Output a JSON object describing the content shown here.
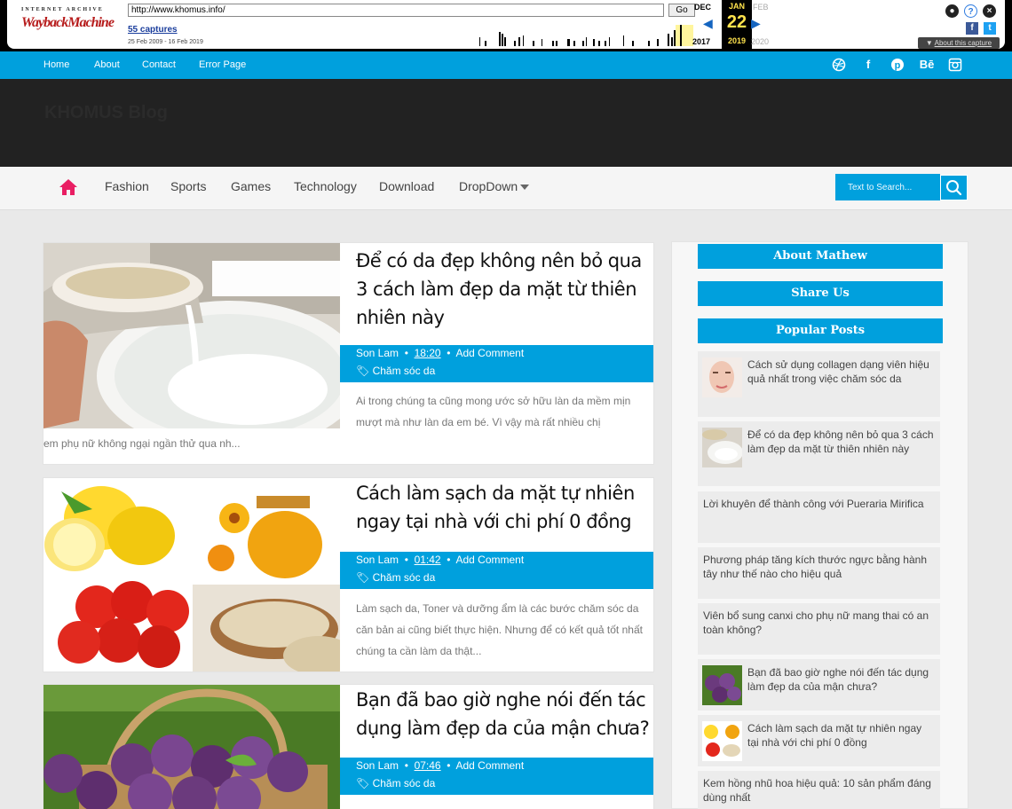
{
  "wayback": {
    "logo_top": "INTERNET ARCHIVE",
    "logo": "WaybackMachine",
    "url": "http://www.khomus.info/",
    "go_label": "Go",
    "captures": "55 captures",
    "range": "25 Feb 2009 - 16 Feb 2019",
    "prev_month": "DEC",
    "cur_month": "JAN",
    "next_month": "FEB",
    "day": "22",
    "prev_year": "2017",
    "cur_year": "2019",
    "next_year": "2020",
    "about": "About this capture"
  },
  "topnav": {
    "items": [
      "Home",
      "About",
      "Contact",
      "Error Page"
    ]
  },
  "social": [
    "dribbble-icon",
    "facebook-icon",
    "pinterest-icon",
    "behance-icon",
    "instagram-icon"
  ],
  "header": {
    "site_title": "KHOMUS Blog"
  },
  "mainnav": {
    "items": [
      "Fashion",
      "Sports",
      "Games",
      "Technology",
      "Download",
      "DropDown"
    ],
    "search_placeholder": "Text to Search..."
  },
  "posts": [
    {
      "title": "Để có da đẹp không nên bỏ qua 3 cách làm đẹp da mặt từ thiên nhiên này",
      "author": "Son Lam",
      "time": "18:20",
      "comment": "Add Comment",
      "category": "Chăm sóc da",
      "excerpt": "Ai trong chúng ta cũng mong ước sở hữu làn da mềm mịn mượt mà như làn da em bé. Vì vậy mà rất nhiều chị em phụ nữ không ngại ngần thử qua nh..."
    },
    {
      "title": "Cách làm sạch da mặt tự nhiên ngay tại nhà với chi phí 0 đồng",
      "author": "Son Lam",
      "time": "01:42",
      "comment": "Add Comment",
      "category": "Chăm sóc da",
      "excerpt": "Làm sạch da, Toner và dưỡng ẩm là các bước chăm sóc da căn bản ai cũng biết thực hiện. Nhưng để có kết quả tốt nhất chúng ta cần làm da thật..."
    },
    {
      "title": "Bạn đã bao giờ nghe nói đến tác dụng làm đẹp da của mận chưa?",
      "author": "Son Lam",
      "time": "07:46",
      "comment": "Add Comment",
      "category": "Chăm sóc da"
    }
  ],
  "sidebar": {
    "about_title": "About Mathew",
    "share_title": "Share Us",
    "popular_title": "Popular Posts",
    "popular": [
      "Cách sử dụng collagen dạng viên hiệu quả nhất trong việc chăm sóc da",
      "Để có da đẹp không nên bỏ qua 3 cách làm đẹp da mặt từ thiên nhiên này",
      "Lời khuyên để thành công với Pueraria Mirifica",
      "Phương pháp tăng kích thước ngực bằng hành tây như thế nào cho hiệu quả",
      "Viên bổ sung canxi cho phụ nữ mang thai có an toàn không?",
      "Bạn đã bao giờ nghe nói đến tác dụng làm đẹp da của mận chưa?",
      "Cách làm sạch da mặt tự nhiên ngay tại nhà với chi phí 0 đồng",
      "Kem hồng nhũ hoa hiệu quả: 10 sản phẩm đáng dùng nhất"
    ]
  }
}
